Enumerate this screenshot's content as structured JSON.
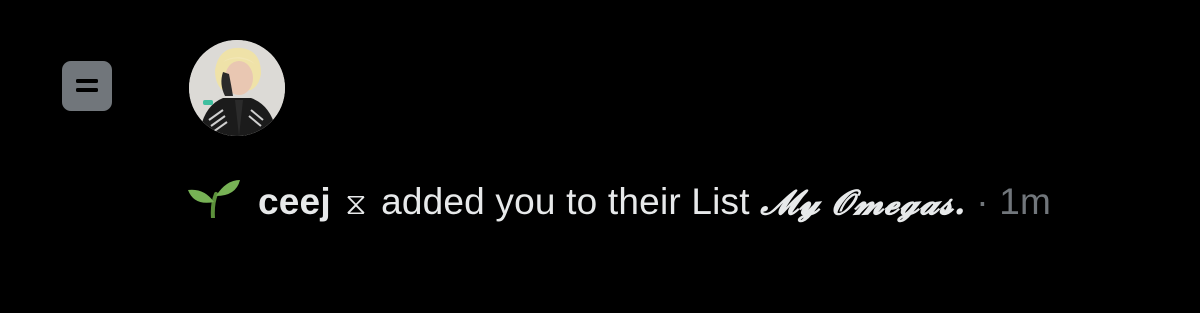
{
  "notification": {
    "type_icon": "list-icon",
    "avatar_alt": "ceej profile photo",
    "leading_emoji": "sprout-icon",
    "username": "ceej",
    "username_suffix": "⧖",
    "action_text": "added you to their List",
    "list_name": "𝓜𝔂 𝓞𝓶𝓮𝓰𝓪𝓼.",
    "separator": "·",
    "timestamp": "1m"
  },
  "colors": {
    "background": "#000000",
    "primary_text": "#e7e9ea",
    "secondary_text": "#71767b",
    "badge": "#71767b",
    "sprout_leaf": "#77b255"
  }
}
